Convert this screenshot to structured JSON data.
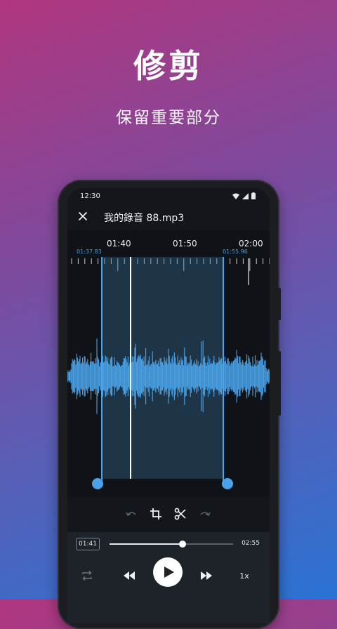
{
  "promo": {
    "title": "修剪",
    "subtitle": "保留重要部分"
  },
  "status_bar": {
    "time": "12:30"
  },
  "app_bar": {
    "title": "我的錄音 88.mp3"
  },
  "timeline": {
    "labels": [
      "01:40",
      "01:50",
      "02:00"
    ],
    "selection_start": "01:37.83",
    "selection_end": "01:55.96"
  },
  "player": {
    "current_time": "01:41",
    "total_time": "02:55",
    "progress": 0.59,
    "speed": "1x"
  },
  "icons": {
    "close": "close-icon",
    "undo": "undo-icon",
    "crop": "crop-icon",
    "scissors": "scissors-icon",
    "redo": "redo-icon",
    "repeat": "repeat-icon",
    "rewind": "rewind-icon",
    "play": "play-icon",
    "fast_forward": "fast-forward-icon"
  },
  "colors": {
    "accent": "#4aa3e8",
    "background_top": "#b0367e",
    "background_bottom": "#2a73d4",
    "screen_bg": "#13161b",
    "player_bg": "#1e2229"
  }
}
